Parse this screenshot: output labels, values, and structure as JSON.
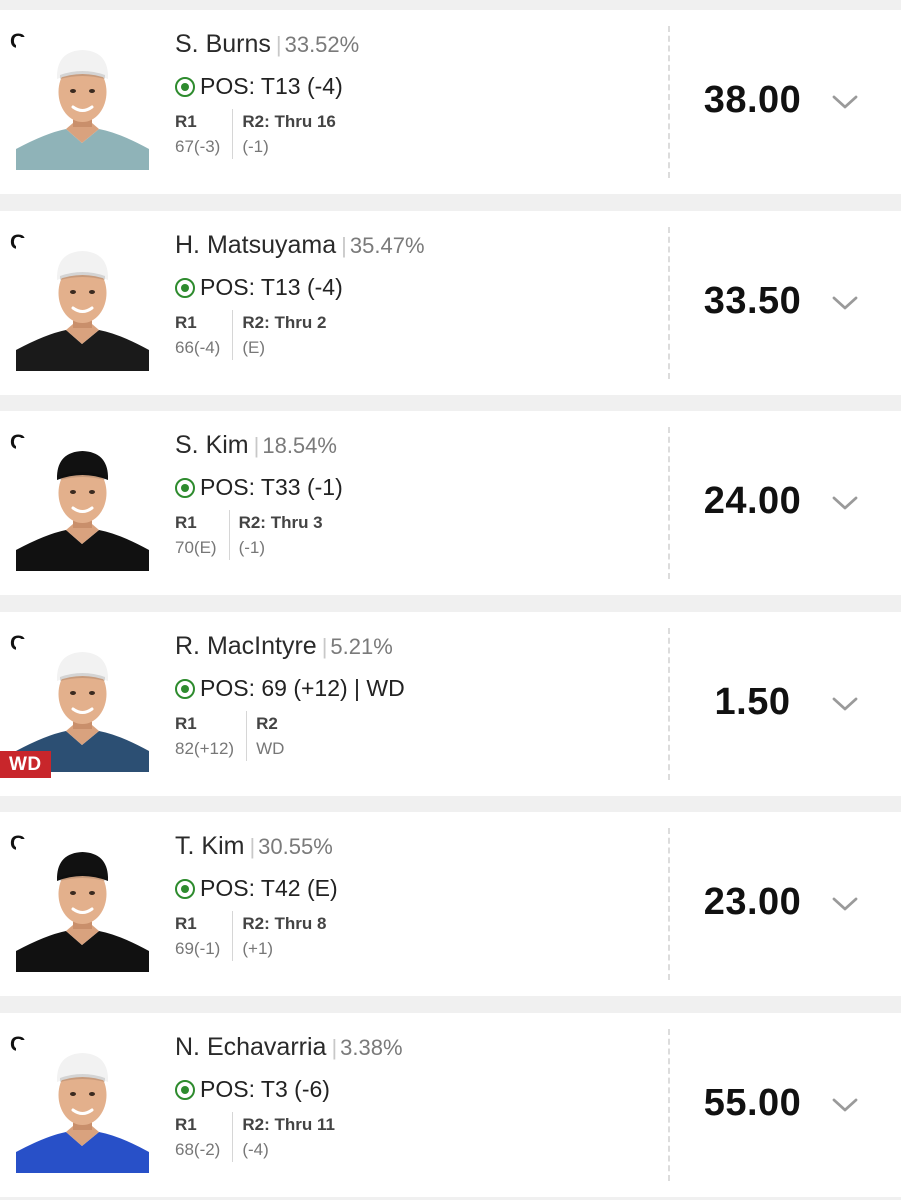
{
  "players": [
    {
      "position_tag": "G",
      "name": "S. Burns",
      "ownership": "33.52%",
      "pos_text": "POS: T13 (-4)",
      "round1_label": "R1",
      "round1_score": "67(-3)",
      "round2_label": "R2: Thru 16",
      "round2_score": "(-1)",
      "points": "38.00",
      "status_tag": "",
      "shirt_color": "#8fb3b8",
      "cap_color": "#f2f2f2"
    },
    {
      "position_tag": "G",
      "name": "H. Matsuyama",
      "ownership": "35.47%",
      "pos_text": "POS: T13 (-4)",
      "round1_label": "R1",
      "round1_score": "66(-4)",
      "round2_label": "R2: Thru 2",
      "round2_score": "(E)",
      "points": "33.50",
      "status_tag": "",
      "shirt_color": "#1a1a1a",
      "cap_color": "#f2f2f2"
    },
    {
      "position_tag": "G",
      "name": "S. Kim",
      "ownership": "18.54%",
      "pos_text": "POS: T33 (-1)",
      "round1_label": "R1",
      "round1_score": "70(E)",
      "round2_label": "R2: Thru 3",
      "round2_score": "(-1)",
      "points": "24.00",
      "status_tag": "",
      "shirt_color": "#111111",
      "cap_color": "#111111"
    },
    {
      "position_tag": "G",
      "name": "R. MacIntyre",
      "ownership": "5.21%",
      "pos_text": "POS: 69 (+12) | WD",
      "round1_label": "R1",
      "round1_score": "82(+12)",
      "round2_label": "R2",
      "round2_score": "WD",
      "points": "1.50",
      "status_tag": "WD",
      "shirt_color": "#2c4f73",
      "cap_color": "#f2f2f2"
    },
    {
      "position_tag": "G",
      "name": "T. Kim",
      "ownership": "30.55%",
      "pos_text": "POS: T42 (E)",
      "round1_label": "R1",
      "round1_score": "69(-1)",
      "round2_label": "R2: Thru 8",
      "round2_score": "(+1)",
      "points": "23.00",
      "status_tag": "",
      "shirt_color": "#111111",
      "cap_color": "#111111"
    },
    {
      "position_tag": "G",
      "name": "N. Echavarria",
      "ownership": "3.38%",
      "pos_text": "POS: T3 (-6)",
      "round1_label": "R1",
      "round1_score": "68(-2)",
      "round2_label": "R2: Thru 11",
      "round2_score": "(-4)",
      "points": "55.00",
      "status_tag": "",
      "shirt_color": "#2850c8",
      "cap_color": "#f2f2f2"
    }
  ],
  "colors": {
    "live_green": "#2e8b2e",
    "wd_red": "#c8262b",
    "page_bg": "#f0f0f0",
    "card_bg": "#ffffff"
  },
  "icons": {
    "live": "live-status-icon",
    "expand": "chevron-down-icon",
    "photo": "player-photo"
  }
}
